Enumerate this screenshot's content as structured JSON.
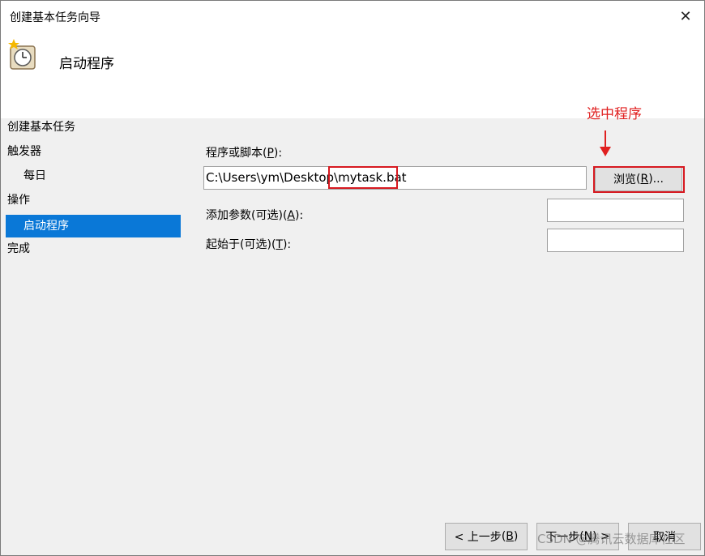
{
  "window": {
    "title": "创建基本任务向导",
    "close_glyph": "✕"
  },
  "header": {
    "title": "启动程序",
    "icon": "clock-task-icon"
  },
  "sidebar": {
    "items": [
      {
        "label": "创建基本任务"
      },
      {
        "label": "触发器"
      },
      {
        "label": "每日"
      },
      {
        "label": "操作"
      },
      {
        "label": "启动程序",
        "selected": true
      },
      {
        "label": "完成"
      }
    ]
  },
  "form": {
    "program_label": "程序或脚本",
    "program_key": "P",
    "program_value_path": "C:\\Users\\ym\\Desktop\\",
    "program_value_file": "mytask.bat",
    "browse_label": "浏览",
    "browse_key": "R",
    "args_label": "添加参数(可选)",
    "args_key": "A",
    "args_value": "",
    "start_label": "起始于(可选)",
    "start_key": "T",
    "start_value": ""
  },
  "annotation": {
    "text": "选中程序",
    "color": "#e02020"
  },
  "footer": {
    "back_label": "< 上一步",
    "back_key": "B",
    "next_label": "下一步",
    "next_key": "N",
    "cancel_label": "取消"
  },
  "watermark": "CSDN @腾讯云数据库社区",
  "colors": {
    "selection": "#0a78d7",
    "annotation_red": "#d71920"
  }
}
